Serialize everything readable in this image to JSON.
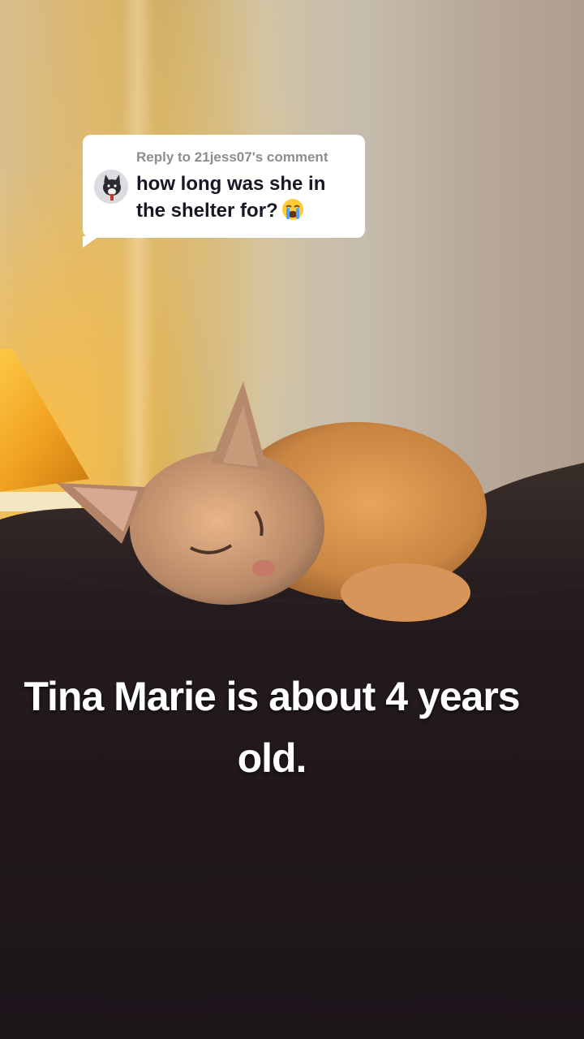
{
  "comment_reply": {
    "reply_label": "Reply to 21jess07's comment",
    "comment": "how long was she in the shelter for?",
    "emoji_icon": "loudly-crying-face-icon"
  },
  "video": {
    "caption": "Tina Marie is about 4 years old."
  },
  "colors": {
    "bubble_bg": "#ffffff",
    "reply_label": "#8d8d91",
    "comment_text": "#161823",
    "caption_text": "#ffffff"
  }
}
